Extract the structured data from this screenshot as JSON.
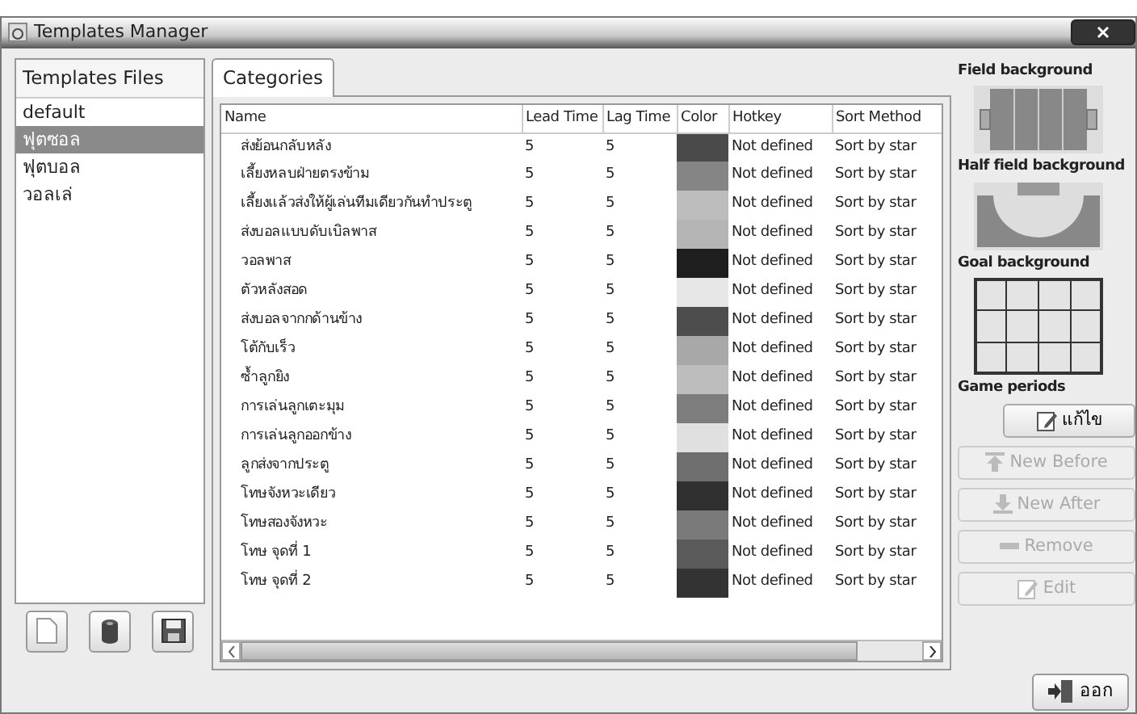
{
  "window": {
    "title": "Templates Manager"
  },
  "templates_files": {
    "heading": "Templates Files",
    "items": [
      {
        "label": "default",
        "selected": false
      },
      {
        "label": "ฟุตซอล",
        "selected": true
      },
      {
        "label": "ฟุตบอล",
        "selected": false
      },
      {
        "label": "วอลเล่",
        "selected": false
      }
    ]
  },
  "tabs": [
    {
      "label": "Categories",
      "selected": true
    }
  ],
  "table": {
    "columns": [
      "Name",
      "Lead Time",
      "Lag Time",
      "Color",
      "Hotkey",
      "Sort Method"
    ],
    "rows": [
      {
        "name": "ส่งย้อนกลับหลัง",
        "lead": "5",
        "lag": "5",
        "color": "#4a4a4a",
        "hotkey": "Not defined",
        "sort": "Sort by star"
      },
      {
        "name": "เลี้ยงหลบฝ่ายตรงข้าม",
        "lead": "5",
        "lag": "5",
        "color": "#858585",
        "hotkey": "Not defined",
        "sort": "Sort by star"
      },
      {
        "name": "เลี้ยงแล้วส่งให้ผู้เล่นทีมเดียวกันทำประตู",
        "lead": "5",
        "lag": "5",
        "color": "#bdbdbd",
        "hotkey": "Not defined",
        "sort": "Sort by star"
      },
      {
        "name": "ส่งบอลแบบดับเบิลพาส",
        "lead": "5",
        "lag": "5",
        "color": "#b5b5b5",
        "hotkey": "Not defined",
        "sort": "Sort by star"
      },
      {
        "name": "วอลพาส",
        "lead": "5",
        "lag": "5",
        "color": "#1e1e1e",
        "hotkey": "Not defined",
        "sort": "Sort by star"
      },
      {
        "name": "ตัวหลังสอด",
        "lead": "5",
        "lag": "5",
        "color": "#e6e6e6",
        "hotkey": "Not defined",
        "sort": "Sort by star"
      },
      {
        "name": "ส่งบอลจากกด้านข้าง",
        "lead": "5",
        "lag": "5",
        "color": "#4d4d4d",
        "hotkey": "Not defined",
        "sort": "Sort by star"
      },
      {
        "name": "โต้กับเร็ว",
        "lead": "5",
        "lag": "5",
        "color": "#a8a8a8",
        "hotkey": "Not defined",
        "sort": "Sort by star"
      },
      {
        "name": "ซ้ำลูกยิง",
        "lead": "5",
        "lag": "5",
        "color": "#bdbdbd",
        "hotkey": "Not defined",
        "sort": "Sort by star"
      },
      {
        "name": "การเล่นลูกเตะมุม",
        "lead": "5",
        "lag": "5",
        "color": "#7d7d7d",
        "hotkey": "Not defined",
        "sort": "Sort by star"
      },
      {
        "name": "การเล่นลูกออกข้าง",
        "lead": "5",
        "lag": "5",
        "color": "#e0e0e0",
        "hotkey": "Not defined",
        "sort": "Sort by star"
      },
      {
        "name": "ลูกส่งจากประตู",
        "lead": "5",
        "lag": "5",
        "color": "#6e6e6e",
        "hotkey": "Not defined",
        "sort": "Sort by star"
      },
      {
        "name": "โทษจังหวะเดียว",
        "lead": "5",
        "lag": "5",
        "color": "#303030",
        "hotkey": "Not defined",
        "sort": "Sort by star"
      },
      {
        "name": "โทษสองจังหวะ",
        "lead": "5",
        "lag": "5",
        "color": "#7a7a7a",
        "hotkey": "Not defined",
        "sort": "Sort by star"
      },
      {
        "name": "โทษ จุดที่ 1",
        "lead": "5",
        "lag": "5",
        "color": "#5a5a5a",
        "hotkey": "Not defined",
        "sort": "Sort by star"
      },
      {
        "name": "โทษ จุดที่ 2",
        "lead": "5",
        "lag": "5",
        "color": "#333333",
        "hotkey": "Not defined",
        "sort": "Sort by star"
      }
    ]
  },
  "side_panel": {
    "field_background": "Field background",
    "half_field_background": "Half field background",
    "goal_background": "Goal background",
    "game_periods": "Game periods",
    "buttons": [
      {
        "label": "แก้ไข",
        "disabled": false,
        "kind": "edit"
      },
      {
        "label": "New Before",
        "disabled": true,
        "kind": "up"
      },
      {
        "label": "New After",
        "disabled": true,
        "kind": "down"
      },
      {
        "label": "Remove",
        "disabled": true,
        "kind": "minus"
      },
      {
        "label": "Edit",
        "disabled": true,
        "kind": "edit"
      }
    ]
  },
  "exit_button": {
    "label": "ออก"
  }
}
